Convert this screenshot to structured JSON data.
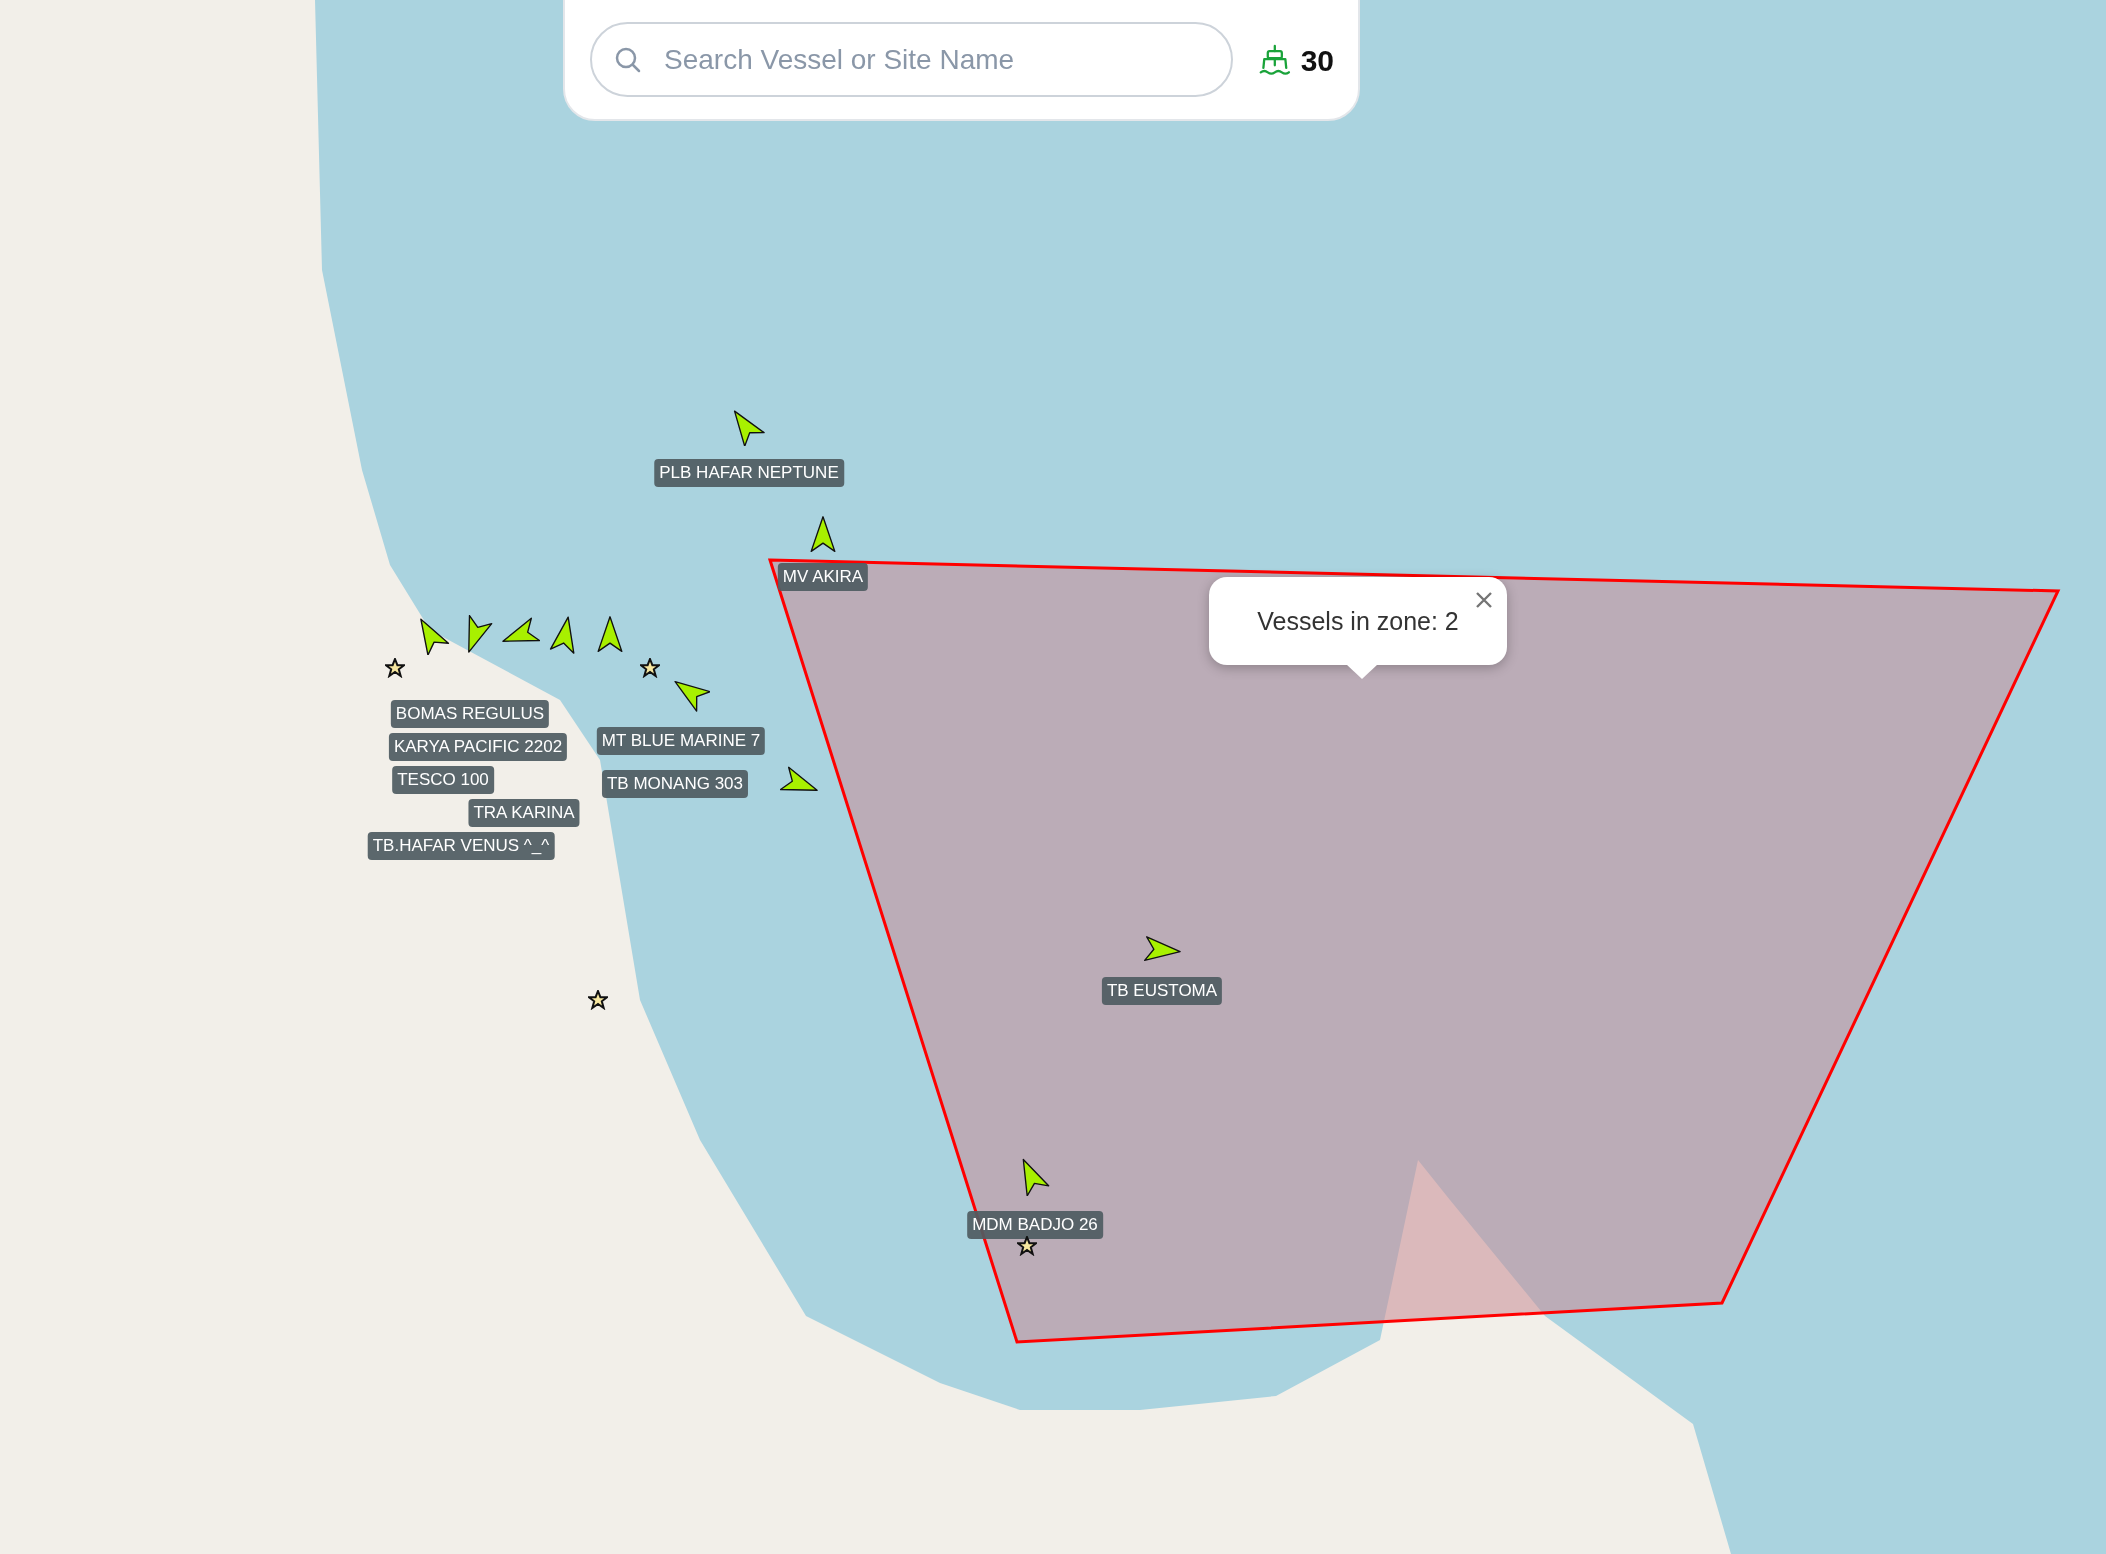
{
  "search": {
    "placeholder": "Search Vessel or Site Name"
  },
  "vessel_count": "30",
  "zone_popup": {
    "text": "Vessels in zone: 2"
  },
  "vessels": [
    {
      "name": "PLB HAFAR NEPTUNE"
    },
    {
      "name": "MV AKIRA"
    },
    {
      "name": "BOMAS REGULUS"
    },
    {
      "name": "KARYA PACIFIC 2202"
    },
    {
      "name": "TESCO 100"
    },
    {
      "name": "TRA KARINA"
    },
    {
      "name": "TB.HAFAR VENUS ^_^"
    },
    {
      "name": "MT BLUE MARINE 7"
    },
    {
      "name": "TB MONANG 303"
    },
    {
      "name": "TB EUSTOMA"
    },
    {
      "name": "MDM BADJO 26"
    }
  ]
}
